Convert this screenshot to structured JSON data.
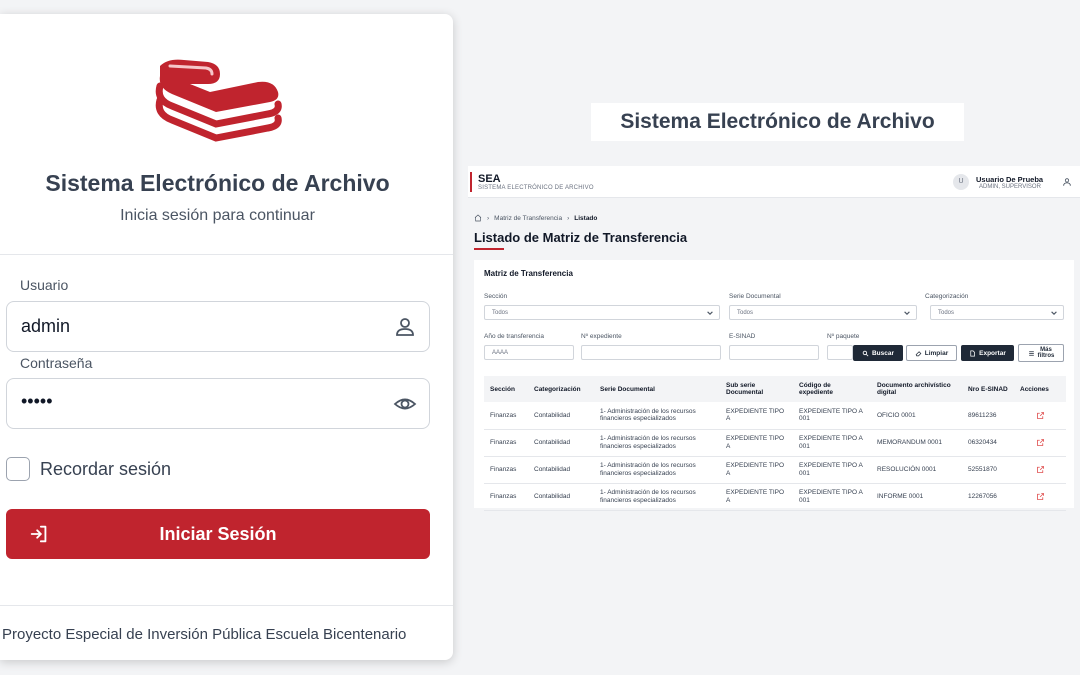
{
  "login": {
    "title": "Sistema Electrónico de Archivo",
    "subtitle": "Inicia sesión para continuar",
    "username_label": "Usuario",
    "username_value": "admin",
    "password_label": "Contraseña",
    "password_value": "•••••",
    "remember_label": "Recordar sesión",
    "submit_label": "Iniciar Sesión",
    "footer": "Proyecto Especial de Inversión Pública Escuela Bicentenario"
  },
  "showcase_title": "Sistema Electrónico de Archivo",
  "app": {
    "brand": "SEA",
    "brand_subtitle": "SISTEMA ELECTRÓNICO DE ARCHIVO",
    "user_initial": "U",
    "user_name": "Usuario De Prueba",
    "user_role": "ADMIN, SUPERVISOR",
    "breadcrumb": [
      "Matriz de Transferencia",
      "Listado"
    ],
    "page_title": "Listado de Matriz de Transferencia",
    "panel_title": "Matriz de Transferencia",
    "filters": {
      "seccion_label": "Sección",
      "seccion_value": "Todos",
      "serie_label": "Serie Documental",
      "serie_value": "Todos",
      "categ_label": "Categorización",
      "categ_value": "Todos",
      "anio_label": "Año de transferencia",
      "anio_placeholder": "AAAA",
      "expediente_label": "Nº expediente",
      "esinad_label": "E-SINAD",
      "paquete_label": "Nº paquete"
    },
    "buttons": {
      "buscar": "Buscar",
      "limpiar": "Limpiar",
      "exportar": "Exportar",
      "mas_filtros_1": "Más",
      "mas_filtros_2": "filtros"
    },
    "table": {
      "headers": [
        "Sección",
        "Categorización",
        "Serie Documental",
        "Sub serie Documental",
        "Código de expediente",
        "Documento archivístico digital",
        "Nro E-SINAD",
        "Acciones"
      ],
      "rows": [
        [
          "Finanzas",
          "Contabilidad",
          "1- Administración de los recursos financieros especializados",
          "EXPEDIENTE TIPO A",
          "EXPEDIENTE TIPO A 001",
          "OFICIO 0001",
          "89611236"
        ],
        [
          "Finanzas",
          "Contabilidad",
          "1- Administración de los recursos financieros especializados",
          "EXPEDIENTE TIPO A",
          "EXPEDIENTE TIPO A 001",
          "MEMORANDUM 0001",
          "06320434"
        ],
        [
          "Finanzas",
          "Contabilidad",
          "1- Administración de los recursos financieros especializados",
          "EXPEDIENTE TIPO A",
          "EXPEDIENTE TIPO A 001",
          "RESOLUCIÓN 0001",
          "52551870"
        ],
        [
          "Finanzas",
          "Contabilidad",
          "1- Administración de los recursos financieros especializados",
          "EXPEDIENTE TIPO A",
          "EXPEDIENTE TIPO A 001",
          "INFORME 0001",
          "12267056"
        ]
      ]
    }
  },
  "colors": {
    "accent": "#c0242e",
    "dark_button": "#1f2937",
    "background": "#f3f4f6"
  }
}
